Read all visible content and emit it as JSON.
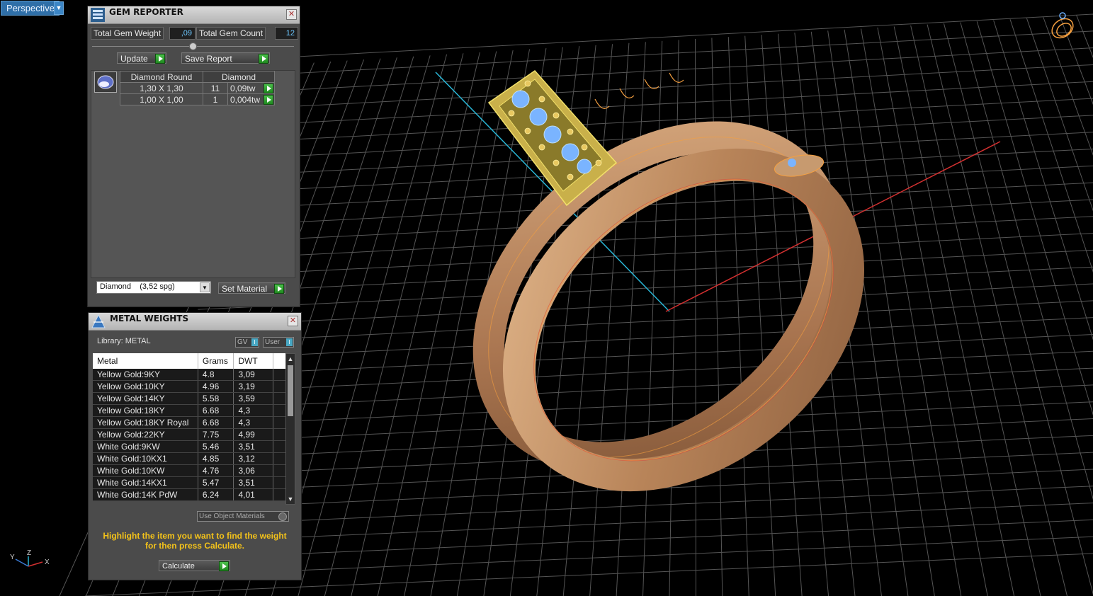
{
  "viewport": {
    "label": "Perspective"
  },
  "gem_reporter": {
    "title": "GEM REPORTER",
    "total_weight_label": "Total Gem Weight",
    "total_weight_value": ",09",
    "total_count_label": "Total Gem Count",
    "total_count_value": "12",
    "update_label": "Update",
    "save_report_label": "Save Report",
    "table_headers": [
      "Diamond Round",
      "Diamond"
    ],
    "rows": [
      {
        "size": "1,30 X 1,30",
        "count": "11",
        "tw": "0,09tw"
      },
      {
        "size": "1,00 X 1,00",
        "count": "1",
        "tw": "0,004tw"
      }
    ],
    "material_select": "Diamond    (3,52 spg)",
    "set_material_label": "Set Material"
  },
  "metal_weights": {
    "title": "METAL WEIGHTS",
    "library_label": "Library: METAL",
    "gv_label": "GV",
    "user_label": "User",
    "headers": [
      "Metal",
      "Grams",
      "DWT"
    ],
    "rows": [
      {
        "metal": "Yellow Gold:9KY",
        "grams": "4.8",
        "dwt": "3,09"
      },
      {
        "metal": "Yellow Gold:10KY",
        "grams": "4.96",
        "dwt": "3,19"
      },
      {
        "metal": "Yellow Gold:14KY",
        "grams": "5.58",
        "dwt": "3,59"
      },
      {
        "metal": "Yellow Gold:18KY",
        "grams": "6.68",
        "dwt": "4,3"
      },
      {
        "metal": "Yellow Gold:18KY Royal",
        "grams": "6.68",
        "dwt": "4,3"
      },
      {
        "metal": "Yellow Gold:22KY",
        "grams": "7.75",
        "dwt": "4,99"
      },
      {
        "metal": "White Gold:9KW",
        "grams": "5.46",
        "dwt": "3,51"
      },
      {
        "metal": "White Gold:10KX1",
        "grams": "4.85",
        "dwt": "3,12"
      },
      {
        "metal": "White Gold:10KW",
        "grams": "4.76",
        "dwt": "3,06"
      },
      {
        "metal": "White Gold:14KX1",
        "grams": "5.47",
        "dwt": "3,51"
      },
      {
        "metal": "White Gold:14K PdW",
        "grams": "6.24",
        "dwt": "4,01"
      }
    ],
    "use_object_materials_label": "Use Object Materials",
    "hint": "Highlight the item you want to find the weight for then press Calculate.",
    "calculate_label": "Calculate"
  },
  "axis": {
    "x": "X",
    "y": "Y",
    "z": "Z"
  },
  "colors": {
    "ring_gold": "#c79a6f",
    "wire_orange": "#f6a040",
    "gem_blue": "#6ab0ff",
    "grid": "#5a5a5a",
    "axis_red": "#d23030",
    "axis_cyan": "#29b6d6",
    "hint_yellow": "#f3c21a"
  }
}
